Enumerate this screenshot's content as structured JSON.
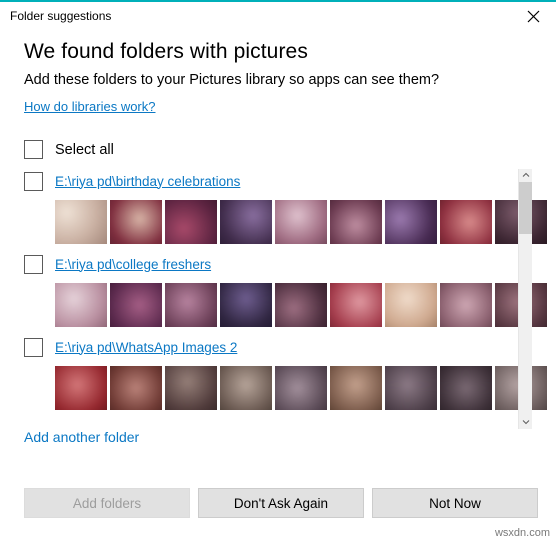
{
  "window": {
    "title": "Folder suggestions",
    "close_icon": "close-icon",
    "accent_color": "#00b0b9"
  },
  "main": {
    "heading": "We found folders with pictures",
    "subheading": "Add these folders to your Pictures library so apps can see them?",
    "help_link": "How do libraries work?",
    "select_all_label": "Select all",
    "add_another_label": "Add another folder"
  },
  "groups": [
    {
      "path": "E:\\riya pd\\birthday celebrations",
      "checked": false,
      "thumbs": [
        {
          "c1": "#cbb2a4",
          "c2": "#8d6f63",
          "c3": "#efe2d6"
        },
        {
          "c1": "#7d2b3c",
          "c2": "#d9b6a8",
          "c3": "#47202c"
        },
        {
          "c1": "#5b2340",
          "c2": "#a94a6a",
          "c3": "#2b1020"
        },
        {
          "c1": "#3f2b4a",
          "c2": "#8a6fa0",
          "c3": "#1d1226"
        },
        {
          "c1": "#a06c82",
          "c2": "#e0c3cf",
          "c3": "#4e2a3b"
        },
        {
          "c1": "#6b3a50",
          "c2": "#c08fa2",
          "c3": "#2f1422"
        },
        {
          "c1": "#472a52",
          "c2": "#9c7bb0",
          "c3": "#22122b"
        },
        {
          "c1": "#8e2f3f",
          "c2": "#d98c8c",
          "c3": "#411418"
        },
        {
          "c1": "#3a2430",
          "c2": "#7d5c6c",
          "c3": "#1a0f16"
        }
      ]
    },
    {
      "path": "E:\\riya pd\\college freshers",
      "checked": false,
      "thumbs": [
        {
          "c1": "#b98fa0",
          "c2": "#e6d3da",
          "c3": "#6c4354"
        },
        {
          "c1": "#5c2a4e",
          "c2": "#a65f86",
          "c3": "#2a1024"
        },
        {
          "c1": "#6a3e56",
          "c2": "#b884a0",
          "c3": "#31182a"
        },
        {
          "c1": "#2f2540",
          "c2": "#6f5e90",
          "c3": "#161026"
        },
        {
          "c1": "#4a2c3c",
          "c2": "#9e6f82",
          "c3": "#23131b"
        },
        {
          "c1": "#a33a4a",
          "c2": "#e09aa2",
          "c3": "#4d1620"
        },
        {
          "c1": "#cfa98f",
          "c2": "#f0dccb",
          "c3": "#7c5b44"
        },
        {
          "c1": "#8a5f6e",
          "c2": "#cfa8b4",
          "c3": "#412830"
        },
        {
          "c1": "#55353f",
          "c2": "#9d737e",
          "c3": "#271a1f"
        }
      ]
    },
    {
      "path": "E:\\riya pd\\WhatsApp Images 2",
      "checked": false,
      "thumbs": [
        {
          "c1": "#93252c",
          "c2": "#d4787a",
          "c3": "#440f12"
        },
        {
          "c1": "#6f3a34",
          "c2": "#bb837a",
          "c3": "#341613"
        },
        {
          "c1": "#4f3a3a",
          "c2": "#968079",
          "c3": "#241a1a"
        },
        {
          "c1": "#6b5a52",
          "c2": "#b7a59a",
          "c3": "#312821"
        },
        {
          "c1": "#5a4a56",
          "c2": "#a3909c",
          "c3": "#2a2028"
        },
        {
          "c1": "#7a5a4a",
          "c2": "#c4a18d",
          "c3": "#372519"
        },
        {
          "c1": "#4c3e48",
          "c2": "#8d7b87",
          "c3": "#231b21"
        },
        {
          "c1": "#3d3038",
          "c2": "#7b6a74",
          "c3": "#1b1418"
        },
        {
          "c1": "#6a5c5c",
          "c2": "#b5a4a4",
          "c3": "#312929"
        }
      ]
    }
  ],
  "scrollbar": {
    "up_arrow": "chevron-up-icon",
    "down_arrow": "chevron-down-icon"
  },
  "footer": {
    "add_folders": "Add folders",
    "dont_ask_again": "Don't Ask Again",
    "not_now": "Not Now"
  },
  "watermark": "wsxdn.com"
}
